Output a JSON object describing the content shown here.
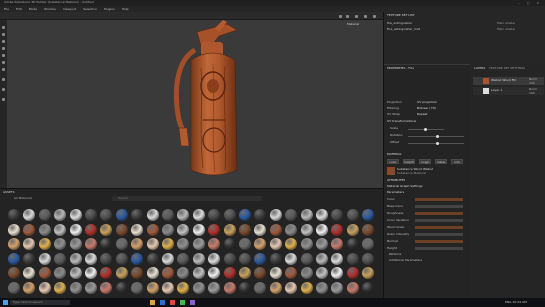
{
  "titlebar": {
    "title": "Adobe Substance 3D Painter (Substance Material) - Untitled"
  },
  "menu": [
    "File",
    "Edit",
    "Mode",
    "Window",
    "Viewport",
    "Selection",
    "Plugins",
    "Help"
  ],
  "viewport": {
    "mode_label": "Material"
  },
  "layers_panel": {
    "tab_label": "TEXTURE SET LIST",
    "items": [
      {
        "label": "fire_extinguisher",
        "value": "Main shader"
      },
      {
        "label": "Fire_extinguisher_mat",
        "value": "Main shader"
      }
    ]
  },
  "properties": {
    "header": "PROPERTIES - FILL",
    "fields": [
      {
        "label": "Projection",
        "value": "UV projection"
      },
      {
        "label": "Filtering",
        "value": "Bilinear | HQ"
      },
      {
        "label": "UV Wrap",
        "value": "Repeat"
      }
    ],
    "uv_header": "UV transformations",
    "sliders": [
      {
        "label": "Scale",
        "value": 0.45
      },
      {
        "label": "Rotation",
        "value": 0.5
      },
      {
        "label": "Offset",
        "value": 0.5
      }
    ],
    "material_header": "MATERIAL",
    "material_buttons": [
      "color",
      "height",
      "rough",
      "metal",
      "nrm"
    ],
    "material_name": "Substance Wood Walnut",
    "material_sub": "Substance Material",
    "attributes_header": "ATTRIBUTES",
    "gen_header": "Material Graph Settings",
    "params_header": "Parameters",
    "params": [
      {
        "label": "Color",
        "value": ""
      },
      {
        "label": "Base Color",
        "value": ""
      },
      {
        "label": "Roughness",
        "value": ""
      },
      {
        "label": "Color Variation",
        "value": ""
      },
      {
        "label": "Wood Grain",
        "value": ""
      },
      {
        "label": "Grain Intensity",
        "value": ""
      },
      {
        "label": "Normal",
        "value": ""
      },
      {
        "label": "Height",
        "value": ""
      }
    ],
    "footer_items": [
      "Patterns",
      "Additional Parameters"
    ]
  },
  "layers": {
    "header": "LAYERS",
    "tab2": "TEXTURE SET SETTINGS",
    "items": [
      {
        "label": "Walnut Wood Fill",
        "blend": "Norm",
        "opacity": "100"
      },
      {
        "label": "Layer 1",
        "blend": "Norm",
        "opacity": "100"
      }
    ]
  },
  "assets": {
    "header": "ASSETS",
    "filter": "All Materials",
    "search_placeholder": "Search"
  },
  "taskbar": {
    "search_placeholder": "Type here to search",
    "clock": "ENG 10:24 AM"
  },
  "colors": {
    "wood": "#a9542c",
    "accent": "#d7863a",
    "panel": "#262626"
  }
}
